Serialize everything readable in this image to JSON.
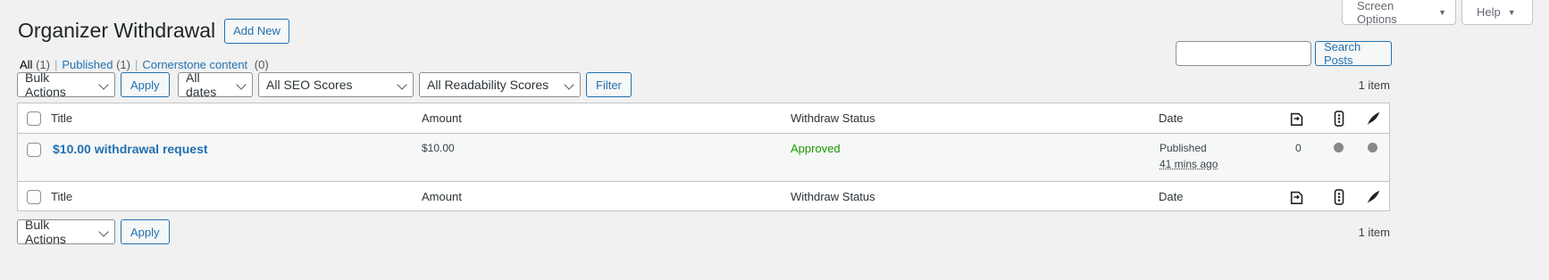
{
  "meta_tabs": {
    "screen_options": "Screen Options",
    "help": "Help"
  },
  "header": {
    "title": "Organizer Withdrawal",
    "add_new": "Add New"
  },
  "views": [
    {
      "label": "All",
      "count": "(1)"
    },
    {
      "label": "Published",
      "count": "(1)"
    },
    {
      "label": "Cornerstone content",
      "count": "(0)"
    }
  ],
  "search": {
    "value": "",
    "button": "Search Posts"
  },
  "filters": {
    "bulk_actions": "Bulk Actions",
    "apply": "Apply",
    "dates": "All dates",
    "seo": "All SEO Scores",
    "readability": "All Readability Scores",
    "filter": "Filter",
    "items_count": "1 item"
  },
  "table": {
    "columns": {
      "title": "Title",
      "amount": "Amount",
      "status": "Withdraw Status",
      "date": "Date"
    },
    "icons": [
      "links-icon",
      "seo-score-icon",
      "readability-icon"
    ],
    "rows": [
      {
        "title": "$10.00 withdrawal request",
        "amount": "$10.00",
        "status": "Approved",
        "date_status": "Published",
        "date_ago": "41 mins ago",
        "links": "0"
      }
    ]
  },
  "bottom": {
    "bulk_actions": "Bulk Actions",
    "apply": "Apply",
    "items_count": "1 item"
  }
}
